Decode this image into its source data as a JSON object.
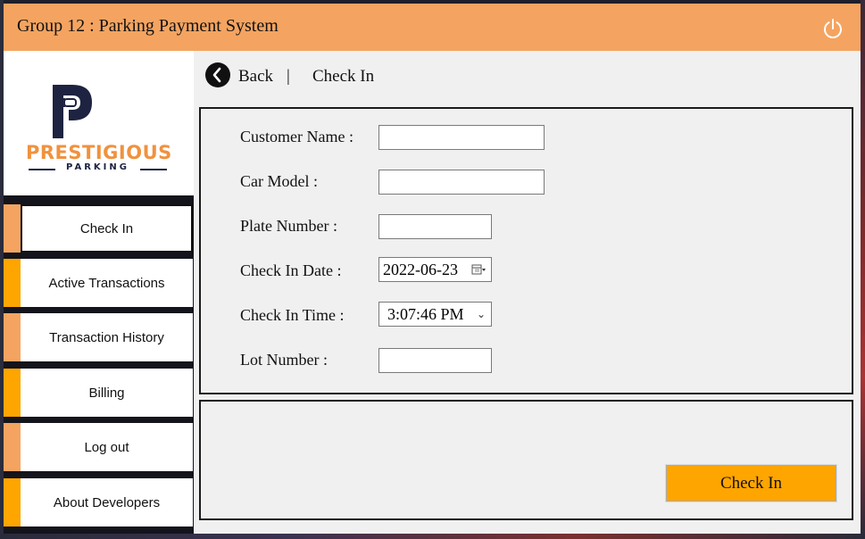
{
  "app": {
    "title": "Group 12 : Parking Payment System"
  },
  "logo": {
    "word": "PRESTIGIOUS",
    "subword": "PARKING",
    "brand_color": "#f0923e",
    "dark_color": "#1d2340"
  },
  "colors": {
    "titlebar": "#f4a460",
    "accent_orange": "#ffa500",
    "accent_light": "#f4a460"
  },
  "nav": {
    "items": [
      {
        "label": "Check In",
        "active": true
      },
      {
        "label": "Active Transactions",
        "active": false
      },
      {
        "label": "Transaction History",
        "active": false
      },
      {
        "label": "Billing",
        "active": false
      },
      {
        "label": "Log out",
        "active": false
      },
      {
        "label": "About Developers",
        "active": false
      }
    ]
  },
  "header": {
    "back_label": "Back",
    "separator": "|",
    "current": "Check In"
  },
  "form": {
    "customer_name": {
      "label": "Customer Name :",
      "value": ""
    },
    "car_model": {
      "label": "Car Model :",
      "value": ""
    },
    "plate_number": {
      "label": "Plate Number :",
      "value": ""
    },
    "check_in_date": {
      "label": "Check In Date :",
      "value": "2022-06-23"
    },
    "check_in_time": {
      "label": "Check In Time :",
      "value": "3:07:46 PM"
    },
    "lot_number": {
      "label": "Lot Number :",
      "value": ""
    }
  },
  "actions": {
    "check_in_label": "Check In"
  },
  "icons": {
    "power": "power-icon",
    "back": "chevron-left-icon",
    "calendar": "calendar-icon",
    "dropdown": "chevron-down-icon"
  }
}
